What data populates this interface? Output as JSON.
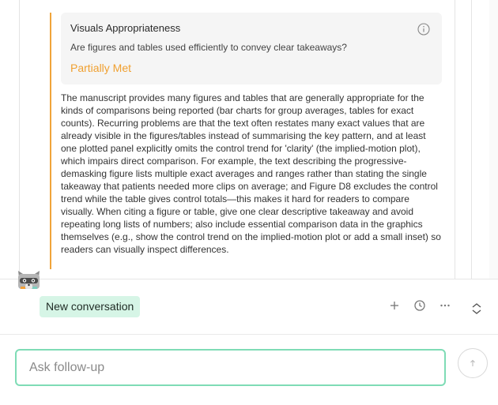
{
  "criterion": {
    "title": "Visuals Appropriateness",
    "question": "Are figures and tables used efficiently to convey clear takeaways?",
    "status": "Partially Met",
    "status_color": "#f0a030",
    "accent_color": "#f0a43a"
  },
  "feedback": {
    "body": "The manuscript provides many figures and tables that are generally appropriate for the kinds of comparisons being reported (bar charts for group averages, tables for exact counts). Recurring problems are that the text often restates many exact values that are already visible in the figures/tables instead of summarising the key pattern, and at least one plotted panel explicitly omits the control trend for 'clarity' (the implied-motion plot), which impairs direct comparison. For example, the text describing the progressive-demasking figure lists multiple exact averages and ranges rather than stating the single takeaway that patients needed more clips on average; and Figure D8 excludes the control trend while the table gives control totals—this makes it hard for readers to compare visually. When citing a figure or table, give one clear descriptive takeaway and avoid repeating long lists of numbers; also include essential comparison data in the graphics themselves (e.g., show the control trend on the implied-motion plot or add a small inset) so readers can visually inspect differences."
  },
  "conversation": {
    "label": "New conversation",
    "pill_color": "#d6f5e6"
  },
  "toolbar": {
    "icons": [
      "plus-icon",
      "history-icon",
      "more-icon",
      "expand-collapse-icon"
    ]
  },
  "composer": {
    "placeholder": "Ask follow-up",
    "input_border_color": "#7fdcb6",
    "send_icon": "arrow-up-icon"
  }
}
